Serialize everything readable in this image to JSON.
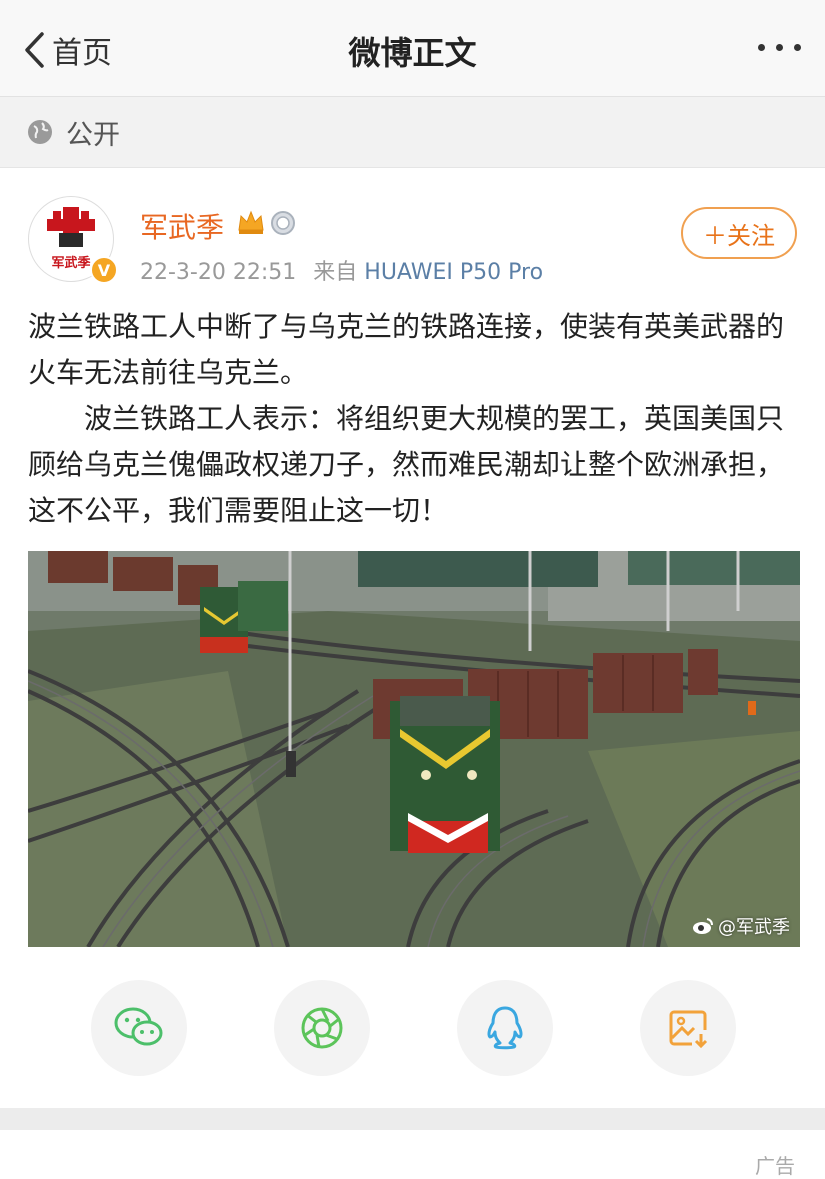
{
  "nav": {
    "back_label": "首页",
    "title": "微博正文"
  },
  "privacy": {
    "label": "公开"
  },
  "author": {
    "name": "军武季",
    "avatar_text": "军武季",
    "verified_mark": "V",
    "time": "22-3-20 22:51",
    "source_prefix": "来自",
    "device": "HUAWEI P50 Pro",
    "follow_label": "＋关注"
  },
  "post": {
    "para1": "波兰铁路工人中断了与乌克兰的铁路连接，使装有英美武器的火车无法前往乌克兰。",
    "para2": "波兰铁路工人表示：将组织更大规模的罢工，英国美国只顾给乌克兰傀儡政权递刀子，然而难民潮却让整个欧洲承担，这不公平，我们需要阻止这一切！"
  },
  "image": {
    "watermark": "@军武季"
  },
  "share": [
    {
      "icon": "wechat-icon"
    },
    {
      "icon": "moments-icon"
    },
    {
      "icon": "qq-icon"
    },
    {
      "icon": "save-image-icon"
    }
  ],
  "colors": {
    "accent": "#e86722",
    "follow_border": "#f0a050",
    "link": "#5b7fa6",
    "wechat": "#4cbf6a",
    "moments": "#5cc45a",
    "qq": "#3aa7e0",
    "save": "#f2a23a"
  },
  "ad": {
    "label": "广告"
  }
}
